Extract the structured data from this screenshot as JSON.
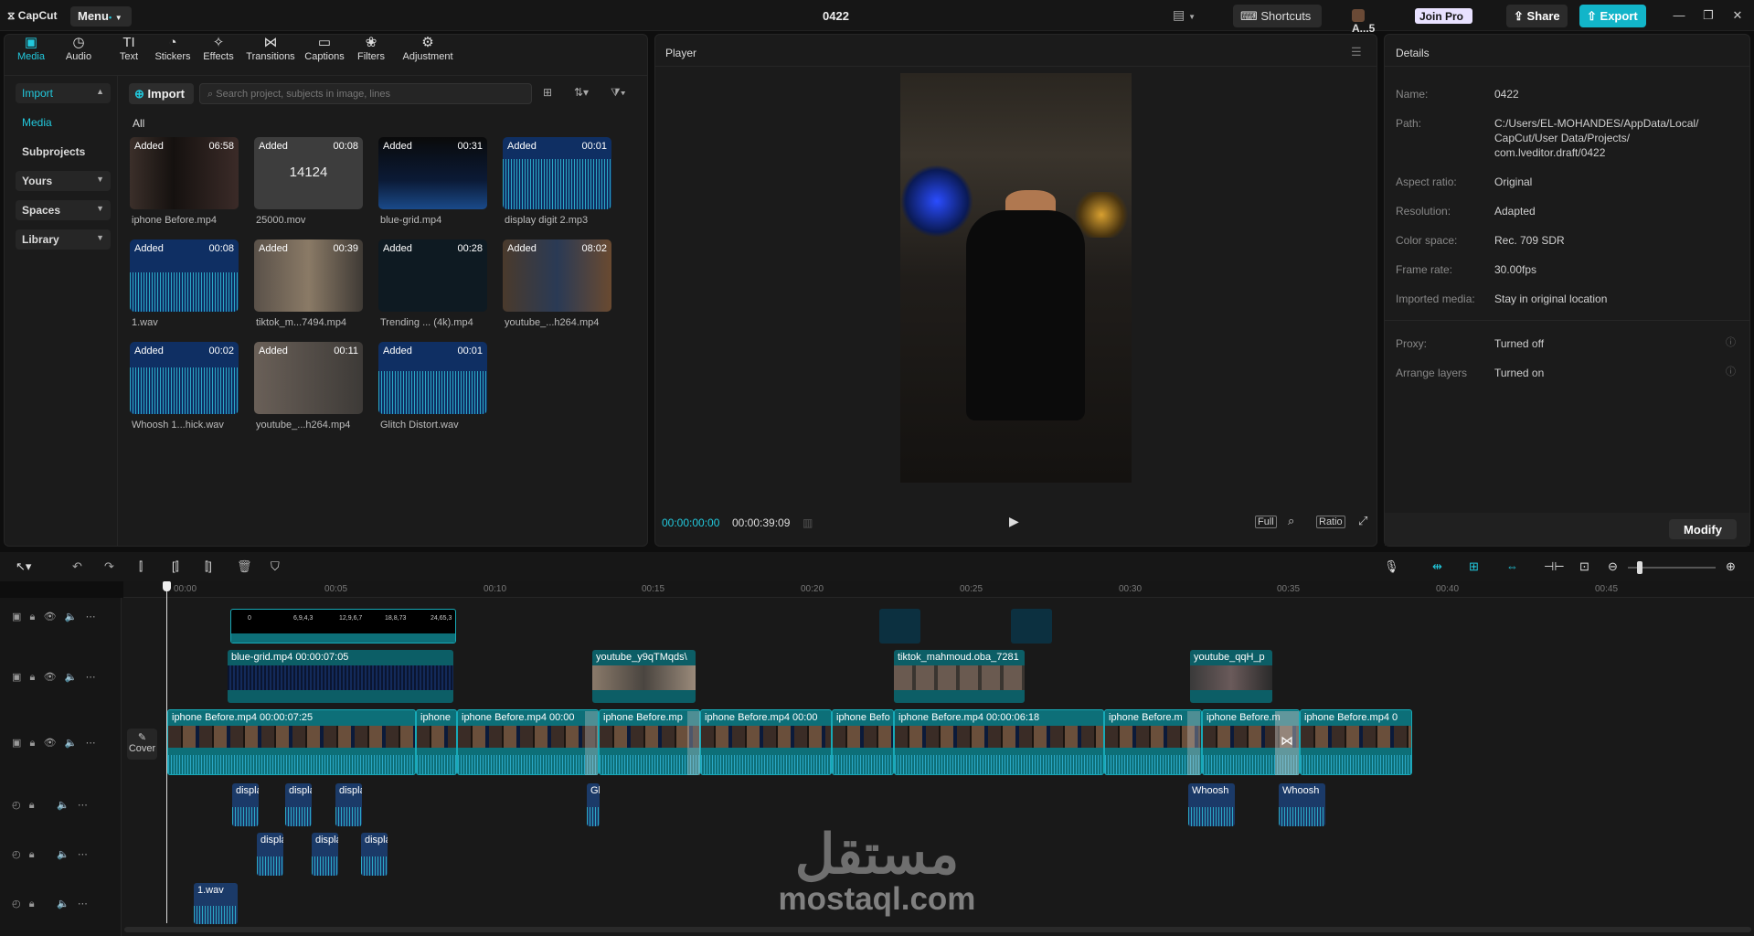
{
  "titlebar": {
    "logo": "CapCut",
    "menu": "Menu",
    "dot": "•",
    "project": "0422",
    "shortcuts": "Shortcuts",
    "user": "A...5",
    "join_pro": "Join Pro",
    "share": "Share",
    "export": "Export"
  },
  "tabs": [
    {
      "label": "Media",
      "icon": "media-icon",
      "active": true
    },
    {
      "label": "Audio",
      "icon": "audio-icon"
    },
    {
      "label": "Text",
      "icon": "text-icon"
    },
    {
      "label": "Stickers",
      "icon": "stickers-icon"
    },
    {
      "label": "Effects",
      "icon": "effects-icon"
    },
    {
      "label": "Transitions",
      "icon": "transitions-icon"
    },
    {
      "label": "Captions",
      "icon": "captions-icon"
    },
    {
      "label": "Filters",
      "icon": "filters-icon"
    },
    {
      "label": "Adjustment",
      "icon": "adjustment-icon"
    }
  ],
  "sidebar": {
    "import": "Import",
    "media": "Media",
    "subprojects": "Subprojects",
    "yours": "Yours",
    "spaces": "Spaces",
    "library": "Library"
  },
  "media": {
    "import_btn": "Import",
    "search_placeholder": "Search project, subjects in image, lines",
    "all": "All",
    "items": [
      {
        "added": "Added",
        "dur": "06:58",
        "name": "iphone Before.mp4"
      },
      {
        "added": "Added",
        "dur": "00:08",
        "name": "25000.mov",
        "big": "14124"
      },
      {
        "added": "Added",
        "dur": "00:31",
        "name": "blue-grid.mp4"
      },
      {
        "added": "Added",
        "dur": "00:01",
        "name": "display digit 2.mp3"
      },
      {
        "added": "Added",
        "dur": "00:08",
        "name": "1.wav"
      },
      {
        "added": "Added",
        "dur": "00:39",
        "name": "tiktok_m...7494.mp4"
      },
      {
        "added": "Added",
        "dur": "00:28",
        "name": "Trending ... (4k).mp4"
      },
      {
        "added": "Added",
        "dur": "08:02",
        "name": "youtube_...h264.mp4"
      },
      {
        "added": "Added",
        "dur": "00:02",
        "name": "Whoosh 1...hick.wav"
      },
      {
        "added": "Added",
        "dur": "00:11",
        "name": "youtube_...h264.mp4"
      },
      {
        "added": "Added",
        "dur": "00:01",
        "name": "Glitch Distort.wav"
      }
    ]
  },
  "player": {
    "title": "Player",
    "time_current": "00:00:00:00",
    "time_total": "00:00:39:09",
    "full": "Full",
    "ratio": "Ratio"
  },
  "details": {
    "title": "Details",
    "rows": [
      {
        "label": "Name:",
        "value": "0422"
      },
      {
        "label": "Path:",
        "value": "C:/Users/EL-MOHANDES/AppData/Local/ CapCut/User Data/Projects/ com.lveditor.draft/0422"
      },
      {
        "label": "Aspect ratio:",
        "value": "Original"
      },
      {
        "label": "Resolution:",
        "value": "Adapted"
      },
      {
        "label": "Color space:",
        "value": "Rec. 709 SDR"
      },
      {
        "label": "Frame rate:",
        "value": "30.00fps"
      },
      {
        "label": "Imported media:",
        "value": "Stay in original location"
      },
      {
        "label": "Proxy:",
        "value": "Turned off"
      },
      {
        "label": "Arrange layers",
        "value": "Turned on"
      }
    ],
    "modify": "Modify"
  },
  "ruler": [
    "00:00",
    "00:05",
    "00:10",
    "00:15",
    "00:20",
    "00:25",
    "00:30",
    "00:35",
    "00:40",
    "00:45"
  ],
  "timeline": {
    "cover": "Cover",
    "top_track_labels": [
      "0",
      "6,9,4,3",
      "12,9,6,7",
      "18,8,73",
      "24,65,3"
    ],
    "overlay_clips": [
      {
        "label": "blue-grid.mp4   00:00:07:05"
      },
      {
        "label": "youtube_y9qTMqds\\"
      },
      {
        "label": "tiktok_mahmoud.oba_7281"
      },
      {
        "label": "youtube_qqH_p"
      }
    ],
    "main_clips": [
      {
        "label": "iphone Before.mp4   00:00:07:25"
      },
      {
        "label": "iphone"
      },
      {
        "label": "iphone Before.mp4   00:00"
      },
      {
        "label": "iphone Before.mp"
      },
      {
        "label": "iphone Before.mp4   00:00"
      },
      {
        "label": "iphone Befo"
      },
      {
        "label": "iphone Before.mp4   00:00:06:18"
      },
      {
        "label": "iphone Before.m"
      },
      {
        "label": "iphone Before.m"
      },
      {
        "label": "iphone Before.mp4   0"
      }
    ],
    "audio1": [
      {
        "label": "displa"
      },
      {
        "label": "displa"
      },
      {
        "label": "displa"
      },
      {
        "label": "Gl"
      },
      {
        "label": "Whoosh"
      },
      {
        "label": "Whoosh"
      }
    ],
    "audio2": [
      {
        "label": "displa"
      },
      {
        "label": "displa"
      },
      {
        "label": "displa"
      }
    ],
    "audio3": [
      {
        "label": "1.wav"
      }
    ]
  },
  "watermark": {
    "arabic": "مستقل",
    "latin": "mostaql.com"
  },
  "colors": {
    "accent": "#22c9dd",
    "export": "#12b5c9",
    "clip": "#0d6f78",
    "audio": "#1b3a68"
  }
}
